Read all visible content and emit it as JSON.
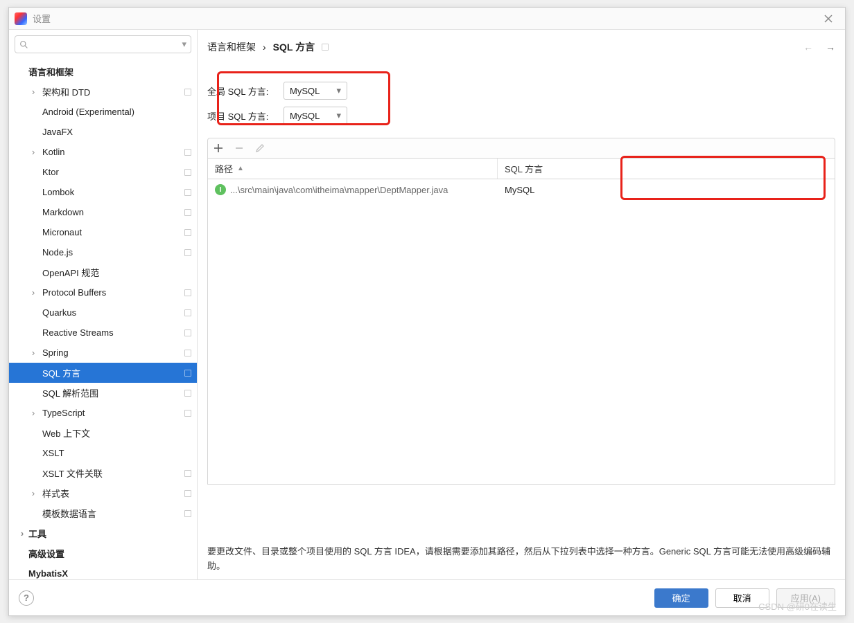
{
  "window": {
    "title": "设置"
  },
  "sidebar": {
    "header": "语言和框架",
    "items": [
      {
        "label": "架构和 DTD",
        "arrow": true,
        "marker": true,
        "level": 2
      },
      {
        "label": "Android (Experimental)",
        "level": 2
      },
      {
        "label": "JavaFX",
        "level": 2
      },
      {
        "label": "Kotlin",
        "arrow": true,
        "marker": true,
        "level": 2
      },
      {
        "label": "Ktor",
        "marker": true,
        "level": 2
      },
      {
        "label": "Lombok",
        "marker": true,
        "level": 2
      },
      {
        "label": "Markdown",
        "marker": true,
        "level": 2
      },
      {
        "label": "Micronaut",
        "marker": true,
        "level": 2
      },
      {
        "label": "Node.js",
        "marker": true,
        "level": 2
      },
      {
        "label": "OpenAPI 规范",
        "level": 2
      },
      {
        "label": "Protocol Buffers",
        "arrow": true,
        "marker": true,
        "level": 2
      },
      {
        "label": "Quarkus",
        "marker": true,
        "level": 2
      },
      {
        "label": "Reactive Streams",
        "marker": true,
        "level": 2
      },
      {
        "label": "Spring",
        "arrow": true,
        "marker": true,
        "level": 2
      },
      {
        "label": "SQL 方言",
        "selected": true,
        "marker": true,
        "level": 2
      },
      {
        "label": "SQL 解析范围",
        "marker": true,
        "level": 2
      },
      {
        "label": "TypeScript",
        "arrow": true,
        "marker": true,
        "level": 2
      },
      {
        "label": "Web 上下文",
        "level": 2
      },
      {
        "label": "XSLT",
        "level": 2
      },
      {
        "label": "XSLT 文件关联",
        "marker": true,
        "level": 2
      },
      {
        "label": "样式表",
        "arrow": true,
        "marker": true,
        "level": 2
      },
      {
        "label": "模板数据语言",
        "marker": true,
        "level": 2
      }
    ],
    "footer_items": [
      {
        "label": "工具",
        "arrow": true
      },
      {
        "label": "高级设置"
      },
      {
        "label": "MybatisX"
      }
    ]
  },
  "breadcrumb": {
    "parent": "语言和框架",
    "sep": "›",
    "current": "SQL 方言"
  },
  "form": {
    "global_label": "全局 SQL 方言:",
    "global_value": "MySQL",
    "project_label": "项目 SQL 方言:",
    "project_value": "MySQL"
  },
  "table": {
    "col_path": "路径",
    "col_dialect": "SQL 方言",
    "rows": [
      {
        "badge": "I",
        "path": "...\\src\\main\\java\\com\\itheima\\mapper\\DeptMapper.java",
        "dialect": "MySQL"
      }
    ]
  },
  "hint": "要更改文件、目录或整个项目使用的 SQL 方言 IDEA，请根据需要添加其路径，然后从下拉列表中选择一种方言。Generic SQL 方言可能无法使用高级编码辅助。",
  "buttons": {
    "ok": "确定",
    "cancel": "取消",
    "apply": "应用(A)"
  },
  "watermark": "CSDN @研0在读生"
}
